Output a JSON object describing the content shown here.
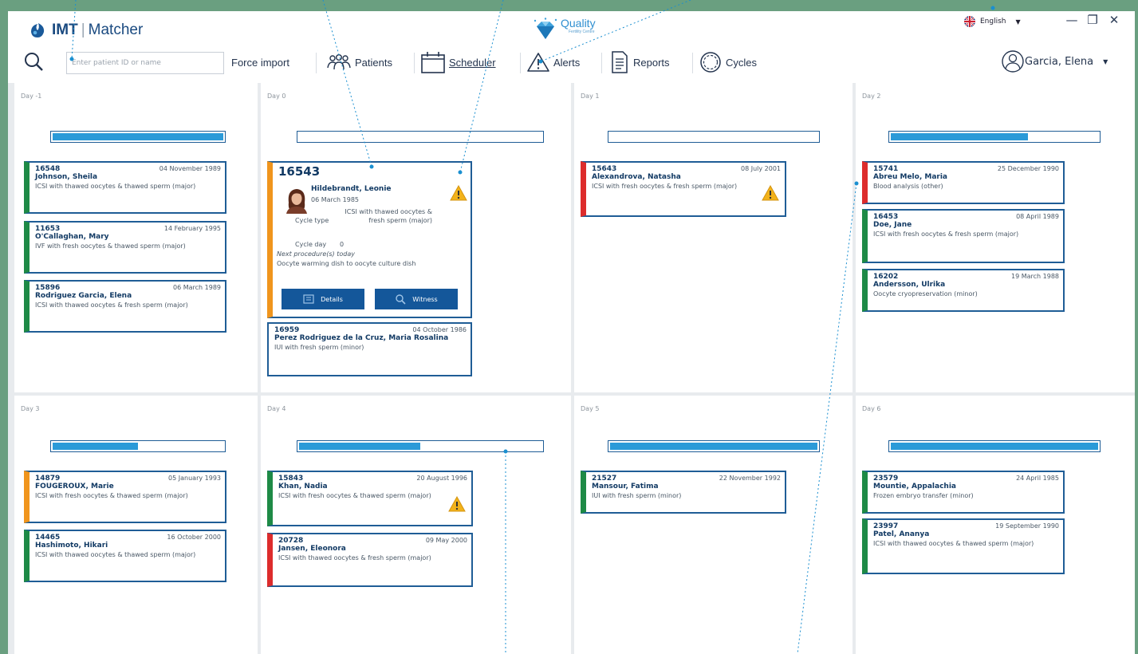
{
  "app": {
    "brand_bold": "IMT",
    "brand_rest": "Matcher",
    "partner_name": "Quality",
    "partner_sub": "Fertility Centre"
  },
  "lang": {
    "label": "English"
  },
  "window": {
    "minimize": "—",
    "restore": "❐",
    "close": "✕"
  },
  "search": {
    "placeholder": "Enter patient ID or name"
  },
  "toolbar": {
    "force_import": "Force import",
    "patients": "Patients",
    "scheduler": "Scheduler",
    "alerts": "Alerts",
    "reports": "Reports",
    "cycles": "Cycles"
  },
  "user": {
    "name": "Garcia, Elena"
  },
  "colors": {
    "accent": "#14579a",
    "progress": "#2b9ad8",
    "green": "#1e8a46",
    "orange": "#f0951d",
    "red": "#dd2c2c",
    "frame": "#6a9f80"
  },
  "days": [
    {
      "label": "Day -1",
      "progress": 1.0,
      "cards": [
        {
          "id": "16548",
          "date": "04 November 1989",
          "name": "Johnson, Sheila",
          "proc": "ICSI with thawed oocytes & thawed sperm (major)",
          "status": "green"
        },
        {
          "id": "11653",
          "date": "14 February 1995",
          "name": "O'Callaghan, Mary",
          "proc": "IVF with fresh oocytes & thawed sperm (major)",
          "status": "green"
        },
        {
          "id": "15896",
          "date": "06 March 1989",
          "name": "Rodriguez Garcia, Elena",
          "proc": "ICSI with thawed oocytes & fresh sperm (major)",
          "status": "green"
        }
      ]
    },
    {
      "label": "Day 0",
      "progress": 0.0,
      "expanded": {
        "id": "16543",
        "name": "Hildebrandt, Leonie",
        "dob": "06 March 1985",
        "cycle_type_label": "Cycle type",
        "cycle_type_value": "ICSI with thawed oocytes & fresh sperm (major)",
        "cycle_day_label": "Cycle day",
        "cycle_day_value": "0",
        "next_label": "Next procedure(s) today",
        "next_value": "Oocyte warming dish to oocyte culture dish",
        "details_button": "Details",
        "witness_button": "Witness",
        "status": "orange"
      },
      "cards": [
        {
          "id": "16959",
          "date": "04 October 1986",
          "name": "Perez Rodriguez de la Cruz, Maria Rosalina",
          "proc": "IUI with fresh sperm (minor)",
          "status": "none"
        }
      ]
    },
    {
      "label": "Day 1",
      "progress": 0.0,
      "cards": [
        {
          "id": "15643",
          "date": "08 July 2001",
          "name": "Alexandrova, Natasha",
          "proc": "ICSI with fresh oocytes & fresh sperm (major)",
          "status": "red",
          "warning": true
        }
      ]
    },
    {
      "label": "Day 2",
      "progress": 0.66,
      "cards": [
        {
          "id": "15741",
          "date": "25 December 1990",
          "name": "Abreu Melo, Maria",
          "proc": "Blood analysis (other)",
          "status": "red"
        },
        {
          "id": "16453",
          "date": "08 April 1989",
          "name": "Doe, Jane",
          "proc": "ICSI with fresh oocytes & fresh sperm (major)",
          "status": "green"
        },
        {
          "id": "16202",
          "date": "19 March 1988",
          "name": "Andersson, Ulrika",
          "proc": "Oocyte cryopreservation (minor)",
          "status": "green"
        }
      ]
    },
    {
      "label": "Day 3",
      "progress": 0.5,
      "cards": [
        {
          "id": "14879",
          "date": "05 January 1993",
          "name": "FOUGEROUX, Marie",
          "proc": "ICSI with fresh oocytes & thawed sperm (major)",
          "status": "orange"
        },
        {
          "id": "14465",
          "date": "16 October 2000",
          "name": "Hashimoto, Hikari",
          "proc": "ICSI with thawed oocytes & thawed sperm (major)",
          "status": "green"
        }
      ]
    },
    {
      "label": "Day 4",
      "progress": 0.5,
      "cards": [
        {
          "id": "15843",
          "date": "20 August 1996",
          "name": "Khan, Nadia",
          "proc": "ICSI with fresh oocytes & thawed sperm (major)",
          "status": "green",
          "warning": true
        },
        {
          "id": "20728",
          "date": "09 May 2000",
          "name": "Jansen, Eleonora",
          "proc": "ICSI with thawed oocytes & fresh sperm (major)",
          "status": "red"
        }
      ]
    },
    {
      "label": "Day 5",
      "progress": 1.0,
      "cards": [
        {
          "id": "21527",
          "date": "22 November 1992",
          "name": "Mansour, Fatima",
          "proc": "IUI with fresh sperm (minor)",
          "status": "green"
        }
      ]
    },
    {
      "label": "Day 6",
      "progress": 1.0,
      "cards": [
        {
          "id": "23579",
          "date": "24 April 1985",
          "name": "Mountie, Appalachia",
          "proc": "Frozen embryo transfer (minor)",
          "status": "green"
        },
        {
          "id": "23997",
          "date": "19 September 1990",
          "name": "Patel, Ananya",
          "proc": "ICSI with thawed oocytes & thawed sperm (major)",
          "status": "green"
        }
      ]
    }
  ]
}
